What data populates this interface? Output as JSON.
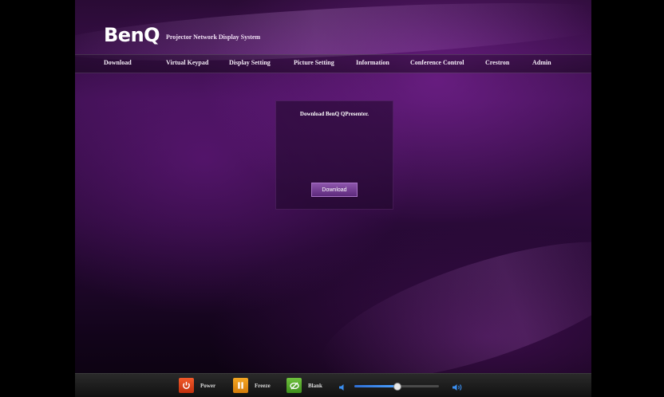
{
  "header": {
    "logo": "BenQ",
    "subtitle": "Projector Network Display System"
  },
  "nav": {
    "items": [
      {
        "label": "Download"
      },
      {
        "label": "Virtual Keypad"
      },
      {
        "label": "Display Setting"
      },
      {
        "label": "Picture Setting"
      },
      {
        "label": "Information"
      },
      {
        "label": "Conference Control"
      },
      {
        "label": "Crestron"
      },
      {
        "label": "Admin"
      }
    ]
  },
  "main": {
    "panel_title": "Download BenQ QPresenter.",
    "download_button": "Download"
  },
  "footer": {
    "power_label": "Power",
    "freeze_label": "Freeze",
    "blank_label": "Blank",
    "volume_level": 0.5
  },
  "colors": {
    "power": "#e0401a",
    "freeze": "#f0951a",
    "blank": "#5aae2e",
    "slider": "#3a8ef0"
  },
  "icons": {
    "power": "power-icon",
    "freeze": "pause-icon",
    "blank": "blank-icon",
    "volume_down": "volume-down-icon",
    "volume_up": "volume-up-icon"
  }
}
